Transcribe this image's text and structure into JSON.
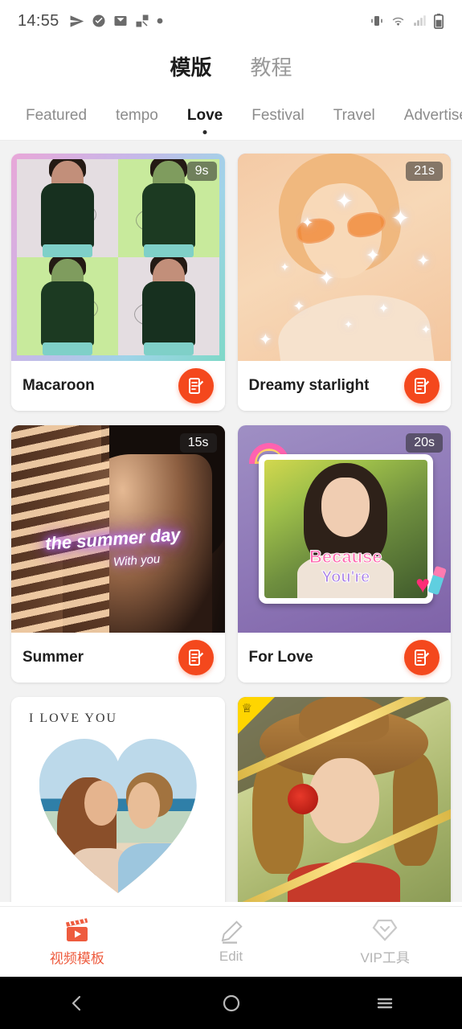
{
  "status_bar": {
    "time": "14:55",
    "left_icons": [
      "send-icon",
      "check-circle-icon",
      "mail-icon",
      "share-nodes-icon",
      "dot-icon"
    ],
    "right_icons": [
      "vibrate-icon",
      "wifi-icon",
      "signal-icon",
      "battery-icon"
    ]
  },
  "header": {
    "top_tabs": [
      {
        "label": "模版",
        "active": true
      },
      {
        "label": "教程",
        "active": false
      }
    ],
    "category_tabs": [
      {
        "label": "Featured",
        "active": false
      },
      {
        "label": "tempo",
        "active": false
      },
      {
        "label": "Love",
        "active": true
      },
      {
        "label": "Festival",
        "active": false
      },
      {
        "label": "Travel",
        "active": false
      },
      {
        "label": "Advertisem",
        "active": false
      }
    ]
  },
  "templates": [
    {
      "title": "Macaroon",
      "duration": "9s",
      "vip": false,
      "art": "macaroon"
    },
    {
      "title": "Dreamy starlight",
      "duration": "21s",
      "vip": false,
      "art": "dreamy"
    },
    {
      "title": "Summer",
      "duration": "15s",
      "vip": false,
      "art": "summer",
      "overlay_text_1": "the summer day",
      "overlay_text_2": "With you"
    },
    {
      "title": "For Love",
      "duration": "20s",
      "vip": false,
      "art": "forlove",
      "overlay_text_1": "Because",
      "overlay_text_2": "You're"
    },
    {
      "title": "",
      "duration": "",
      "vip": false,
      "art": "iloveyou",
      "overlay_text_1": "I LOVE YOU"
    },
    {
      "title": "",
      "duration": "",
      "vip": true,
      "art": "goldhat"
    }
  ],
  "bottom_nav": [
    {
      "label": "视频模板",
      "icon": "clapperboard-icon",
      "active": true
    },
    {
      "label": "Edit",
      "icon": "pencil-icon",
      "active": false
    },
    {
      "label": "VIP工具",
      "icon": "vip-diamond-icon",
      "active": false
    }
  ],
  "android_nav": [
    "back-icon",
    "home-icon",
    "recents-icon"
  ],
  "colors": {
    "accent": "#f4481d",
    "nav_active": "#ee5b3e",
    "text_primary": "#1c1c1c",
    "text_muted": "#8c8c8c",
    "content_bg": "#f2f2f2"
  }
}
